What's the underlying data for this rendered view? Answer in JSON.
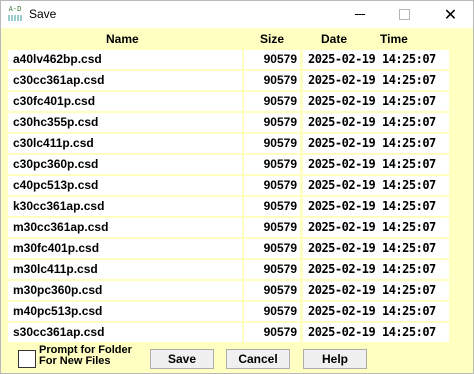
{
  "window": {
    "title": "Save",
    "app_icon": "A-D",
    "minimize": "minimize-icon",
    "maximize": "maximize-icon",
    "close": "close-icon"
  },
  "columns": {
    "name": "Name",
    "size": "Size",
    "date": "Date",
    "time": "Time"
  },
  "files": [
    {
      "name": "a40lv462bp.csd",
      "size": "90579",
      "datetime": "2025-02-19 14:25:07"
    },
    {
      "name": "c30cc361ap.csd",
      "size": "90579",
      "datetime": "2025-02-19 14:25:07"
    },
    {
      "name": "c30fc401p.csd",
      "size": "90579",
      "datetime": "2025-02-19 14:25:07"
    },
    {
      "name": "c30hc355p.csd",
      "size": "90579",
      "datetime": "2025-02-19 14:25:07"
    },
    {
      "name": "c30lc411p.csd",
      "size": "90579",
      "datetime": "2025-02-19 14:25:07"
    },
    {
      "name": "c30pc360p.csd",
      "size": "90579",
      "datetime": "2025-02-19 14:25:07"
    },
    {
      "name": "c40pc513p.csd",
      "size": "90579",
      "datetime": "2025-02-19 14:25:07"
    },
    {
      "name": "k30cc361ap.csd",
      "size": "90579",
      "datetime": "2025-02-19 14:25:07"
    },
    {
      "name": "m30cc361ap.csd",
      "size": "90579",
      "datetime": "2025-02-19 14:25:07"
    },
    {
      "name": "m30fc401p.csd",
      "size": "90579",
      "datetime": "2025-02-19 14:25:07"
    },
    {
      "name": "m30lc411p.csd",
      "size": "90579",
      "datetime": "2025-02-19 14:25:07"
    },
    {
      "name": "m30pc360p.csd",
      "size": "90579",
      "datetime": "2025-02-19 14:25:07"
    },
    {
      "name": "m40pc513p.csd",
      "size": "90579",
      "datetime": "2025-02-19 14:25:07"
    },
    {
      "name": "s30cc361ap.csd",
      "size": "90579",
      "datetime": "2025-02-19 14:25:07"
    }
  ],
  "footer": {
    "prompt_line1": "Prompt for Folder",
    "prompt_line2": "For New Files",
    "prompt_checked": false,
    "save_label": "Save",
    "cancel_label": "Cancel",
    "help_label": "Help"
  },
  "colors": {
    "background": "#ffffc2",
    "cell": "#ffffff"
  }
}
